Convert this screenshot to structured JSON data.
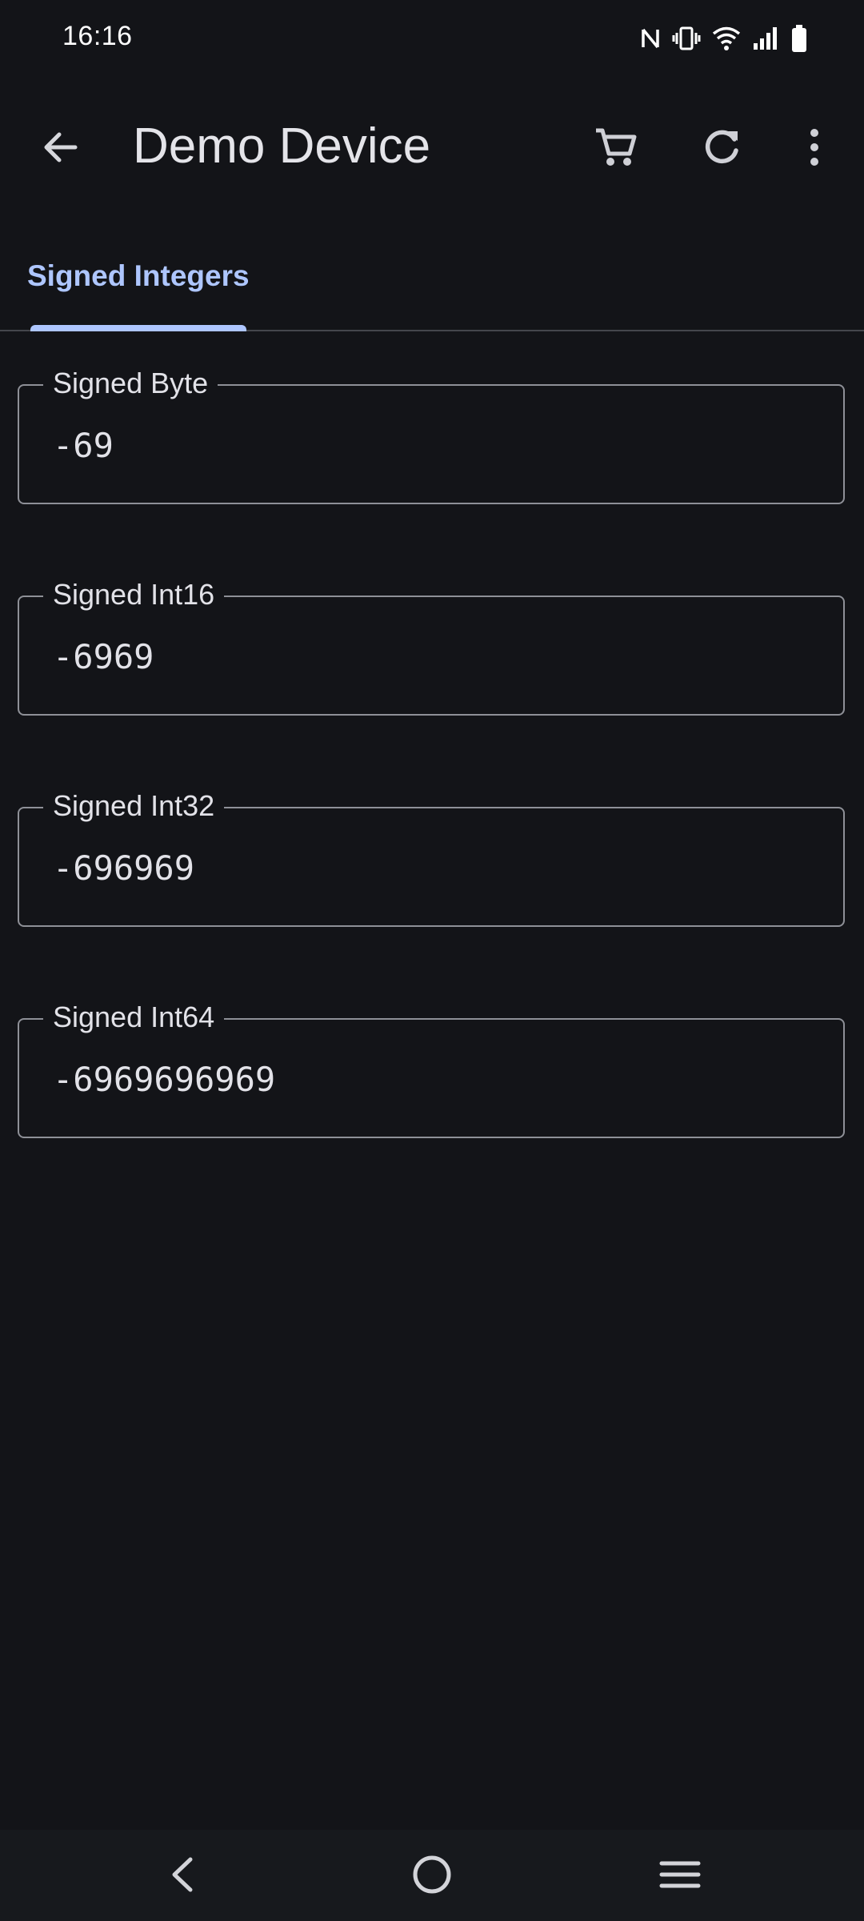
{
  "status_bar": {
    "time": "16:16",
    "icons": [
      "nfc-icon",
      "vibrate-icon",
      "wifi-icon",
      "signal-icon",
      "battery-icon"
    ]
  },
  "app_bar": {
    "title": "Demo Device",
    "icons": [
      "back-arrow-icon",
      "cart-icon",
      "refresh-icon",
      "more-vert-icon"
    ]
  },
  "tabs": [
    {
      "label": "Signed Integers",
      "selected": true
    }
  ],
  "fields": [
    {
      "label": "Signed Byte",
      "value": "-69"
    },
    {
      "label": "Signed Int16",
      "value": "-6969"
    },
    {
      "label": "Signed Int32",
      "value": "-696969"
    },
    {
      "label": "Signed Int64",
      "value": "-6969696969"
    }
  ],
  "nav_bar": {
    "icons": [
      "nav-back-icon",
      "nav-home-icon",
      "nav-recents-icon"
    ]
  },
  "colors": {
    "background": "#131418",
    "accent": "#aec6ff",
    "outline": "#8e9097",
    "text": "#e4e4e9"
  }
}
